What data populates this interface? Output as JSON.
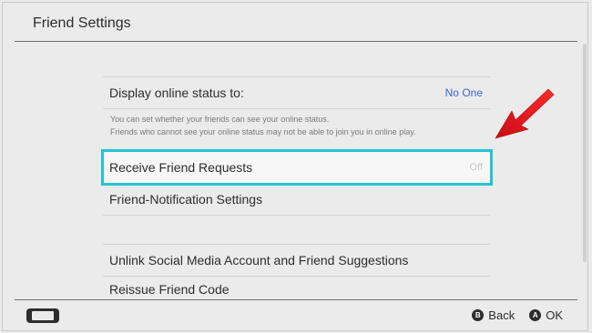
{
  "header": {
    "title": "Friend Settings"
  },
  "settings": {
    "online_status": {
      "label": "Display online status to:",
      "value": "No One",
      "description_1": "You can set whether your friends can see your online status.",
      "description_2": "Friends who cannot see your online status may not be able to join you in online play."
    },
    "receive_requests": {
      "label": "Receive Friend Requests",
      "value": "Off"
    },
    "notification_settings": {
      "label": "Friend-Notification Settings"
    },
    "unlink_social": {
      "label": "Unlink Social Media Account and Friend Suggestions"
    },
    "reissue_code": {
      "label": "Reissue Friend Code"
    }
  },
  "footer": {
    "back_glyph": "B",
    "back_label": "Back",
    "ok_glyph": "A",
    "ok_label": "OK"
  },
  "icons": {
    "console": "console-icon",
    "annotation_arrow_color": "#e0101a",
    "highlight_color": "#23c4d2",
    "accent_blue": "#3b63d9"
  }
}
